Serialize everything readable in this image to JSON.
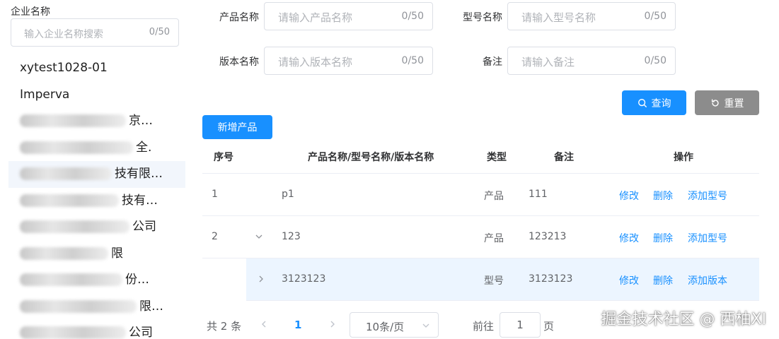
{
  "sidebar": {
    "label": "企业名称",
    "search": {
      "placeholder": "输入企业名称搜索",
      "count": "0/50"
    },
    "items": [
      {
        "label": "xytest1028-01",
        "blurred": false
      },
      {
        "label": "Imperva",
        "blurred": false
      },
      {
        "label": "京…",
        "blurred": true
      },
      {
        "label": "全.",
        "blurred": true
      },
      {
        "label": "技有限…",
        "blurred": true
      },
      {
        "label": "技有…",
        "blurred": true
      },
      {
        "label": "公司",
        "blurred": true
      },
      {
        "label": "限",
        "blurred": true
      },
      {
        "label": "份…",
        "blurred": true
      },
      {
        "label": "限…",
        "blurred": true
      },
      {
        "label": "公司",
        "blurred": true
      }
    ]
  },
  "form": {
    "product_name": {
      "label": "产品名称",
      "placeholder": "请输入产品名称",
      "count": "0/50"
    },
    "model_name": {
      "label": "型号名称",
      "placeholder": "请输入型号名称",
      "count": "0/50"
    },
    "version_name": {
      "label": "版本名称",
      "placeholder": "请输入版本名称",
      "count": "0/50"
    },
    "remark": {
      "label": "备注",
      "placeholder": "请输入备注",
      "count": "0/50"
    }
  },
  "buttons": {
    "query": "查询",
    "reset": "重置",
    "add_product": "新增产品"
  },
  "table": {
    "headers": {
      "index": "序号",
      "name": "产品名称/型号名称/版本名称",
      "type": "类型",
      "remark": "备注",
      "actions": "操作"
    },
    "rows": [
      {
        "index": "1",
        "name": "p1",
        "type": "产品",
        "remark": "111",
        "actions": [
          "修改",
          "删除",
          "添加型号"
        ]
      },
      {
        "index": "2",
        "name": "123",
        "type": "产品",
        "remark": "123213",
        "actions": [
          "修改",
          "删除",
          "添加型号"
        ]
      },
      {
        "index": "",
        "name": "3123123",
        "type": "型号",
        "remark": "3123123",
        "actions": [
          "修改",
          "删除",
          "添加版本"
        ]
      }
    ]
  },
  "pagination": {
    "total": "共 2 条",
    "current": "1",
    "page_size": "10条/页",
    "goto_label": "前往",
    "goto_value": "1",
    "page_unit": "页"
  },
  "watermark": "掘金技术社区 @ 西柚XI",
  "colors": {
    "primary": "#1890ff",
    "reset_button": "#8c8c8c",
    "sub_row_bg": "#ecf5ff"
  }
}
